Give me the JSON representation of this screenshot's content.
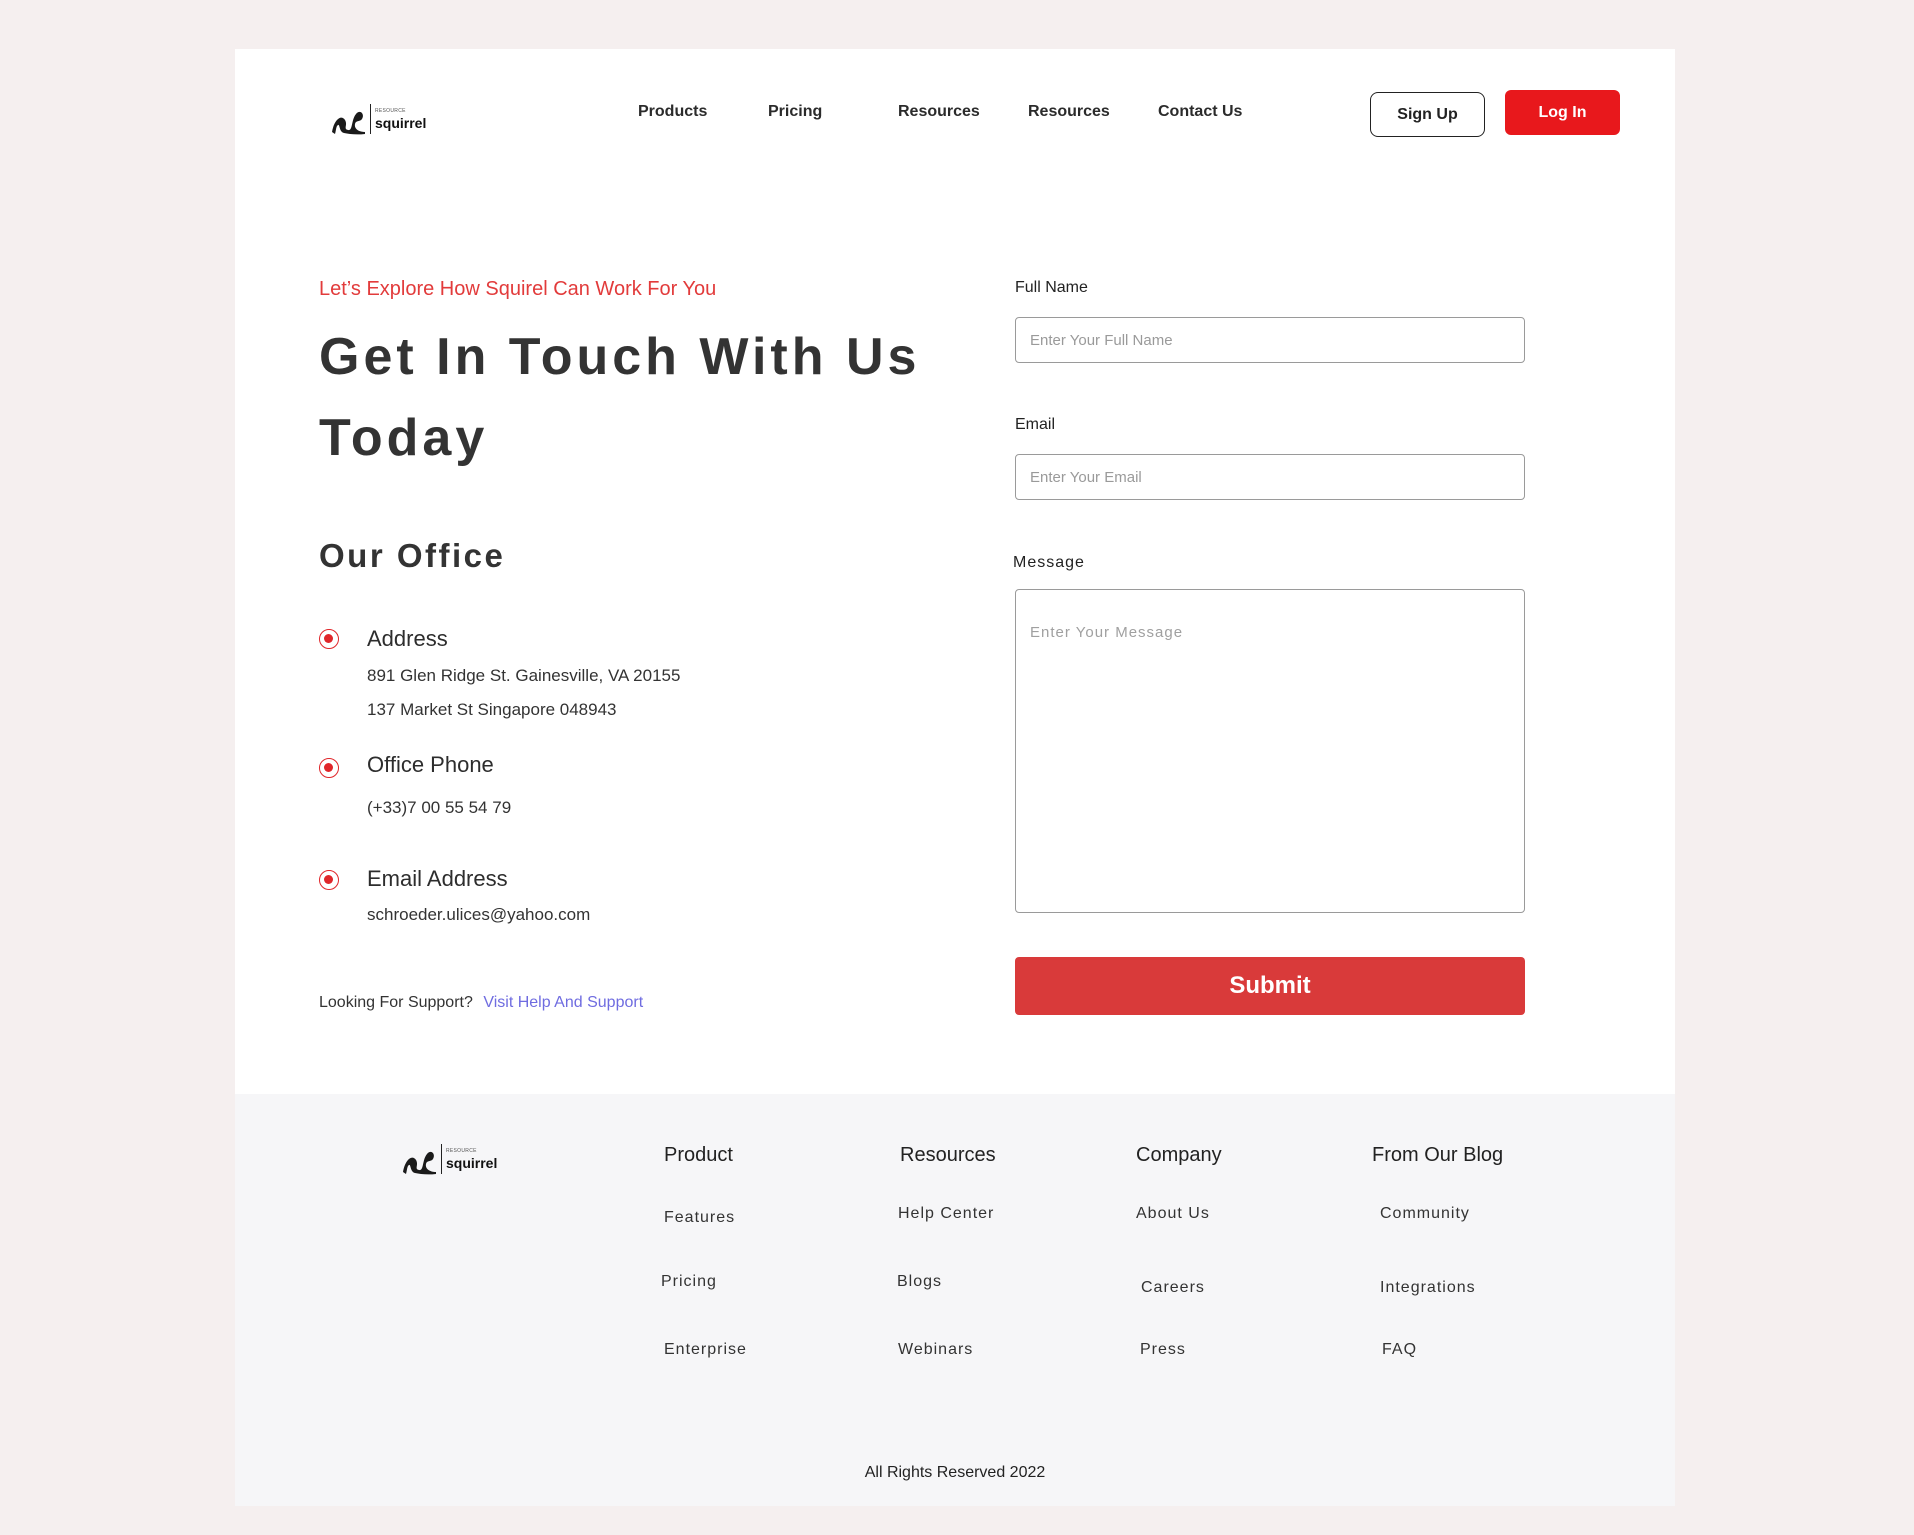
{
  "header": {
    "logo_small": "RESOURCE",
    "logo_big": "squirrel",
    "nav": [
      "Products",
      "Pricing",
      "Resources",
      "Resources",
      "Contact Us"
    ],
    "signup_label": "Sign Up",
    "login_label": "Log In"
  },
  "hero": {
    "tagline": "Let’s Explore How Squirel Can Work For You",
    "headline": "Get In Touch With Us Today",
    "office_title": "Our Office"
  },
  "office": {
    "address_title": "Address",
    "address_line1": "891 Glen Ridge St. Gainesville, VA 20155",
    "address_line2": "137 Market St Singapore 048943",
    "phone_title": "Office Phone",
    "phone": "(+33)7 00 55 54 79",
    "email_title": "Email Address",
    "email": "schroeder.ulices@yahoo.com"
  },
  "support": {
    "text": "Looking For Support?",
    "link": "Visit Help And Support"
  },
  "form": {
    "name_label": "Full Name",
    "name_placeholder": "Enter Your Full Name",
    "email_label": "Email",
    "email_placeholder": "Enter Your Email",
    "message_label": "Message",
    "message_placeholder": "Enter Your Message",
    "submit_label": "Submit"
  },
  "footer": {
    "logo_small": "RESOURCE",
    "logo_big": "squirrel",
    "columns": [
      {
        "title": "Product",
        "items": [
          "Features",
          "Pricing",
          "Enterprise"
        ]
      },
      {
        "title": "Resources",
        "items": [
          "Help Center",
          "Blogs",
          "Webinars"
        ]
      },
      {
        "title": "Company",
        "items": [
          "About Us",
          "Careers",
          "Press"
        ]
      },
      {
        "title": "From Our Blog",
        "items": [
          "Community",
          "Integrations",
          "FAQ"
        ]
      }
    ],
    "copyright": "All Rights Reserved 2022"
  },
  "colors": {
    "accent": "#e8181c",
    "submit": "#d93a3a",
    "tagline": "#e23b3b",
    "link": "#6f6ce0"
  }
}
